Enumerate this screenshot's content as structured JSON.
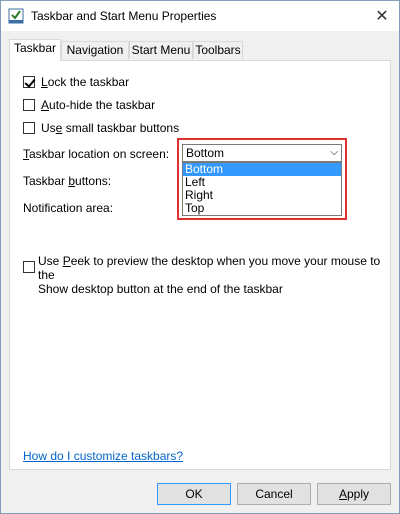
{
  "window": {
    "title": "Taskbar and Start Menu Properties",
    "close_glyph": "✕"
  },
  "tabs": [
    {
      "label": "Taskbar"
    },
    {
      "label": "Navigation"
    },
    {
      "label": "Start Menu"
    },
    {
      "label": "Toolbars"
    }
  ],
  "checkboxes": {
    "lock": {
      "label_pre": "",
      "label_u": "L",
      "label_post": "ock the taskbar",
      "checked": true
    },
    "autohide": {
      "label_pre": "",
      "label_u": "A",
      "label_post": "uto-hide the taskbar",
      "checked": false
    },
    "small": {
      "label_pre": "Us",
      "label_u": "e",
      "label_post": " small taskbar buttons",
      "checked": false
    },
    "peek": {
      "label_pre": "Use ",
      "label_u": "P",
      "label_post": "eek to preview the desktop when you move your mouse to the",
      "label_line2": "Show desktop button at the end of the taskbar",
      "checked": false
    }
  },
  "settings": {
    "location_label_pre": "",
    "location_label_u": "T",
    "location_label_post": "askbar location on screen:",
    "buttons_label_pre": "Taskbar ",
    "buttons_label_u": "b",
    "buttons_label_post": "uttons:",
    "notification_label": "Notification area:"
  },
  "location_select": {
    "value": "Bottom",
    "options": [
      "Bottom",
      "Left",
      "Right",
      "Top"
    ],
    "highlighted": "Bottom"
  },
  "help_link": "How do I customize taskbars?",
  "footer": {
    "ok": "OK",
    "cancel": "Cancel",
    "apply_u": "A",
    "apply_post": "pply"
  },
  "colors": {
    "highlight": "#3399ff",
    "focus_border": "#e03030",
    "link": "#0066cc"
  }
}
